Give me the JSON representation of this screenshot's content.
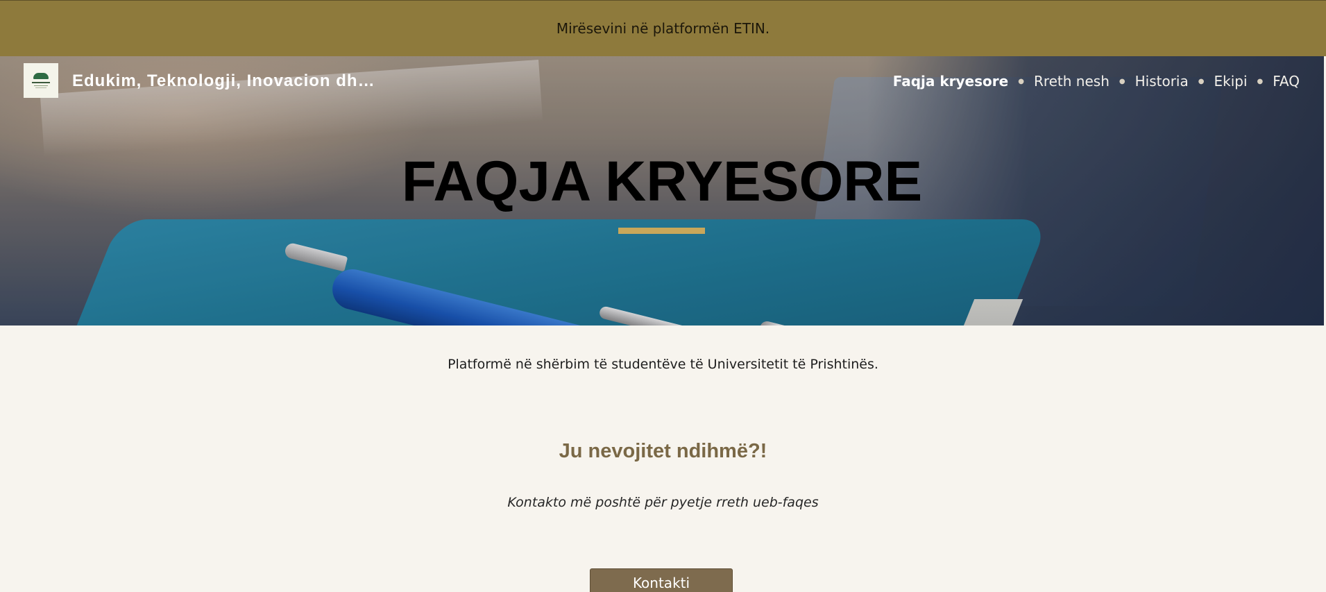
{
  "announcement": {
    "text": "Mirësevini në platformën ETIN."
  },
  "header": {
    "site_title": "Edukim, Teknologji, Inovacion dh…",
    "logo_icon": "etin-logo-icon",
    "nav": [
      {
        "label": "Faqja kryesore",
        "active": true
      },
      {
        "label": "Rreth nesh",
        "active": false
      },
      {
        "label": "Historia",
        "active": false
      },
      {
        "label": "Ekipi",
        "active": false
      },
      {
        "label": "FAQ",
        "active": false
      }
    ]
  },
  "hero": {
    "title": "FAQJA KRYESORE",
    "accent_color": "#c9a75a"
  },
  "content": {
    "tagline": "Platformë në shërbim të studentëve të Universitetit të Prishtinës.",
    "help_heading": "Ju nevojitet ndihmë?!",
    "help_subtext": "Kontakto më poshtë për pyetje rreth ueb-faqes",
    "contact_button": "Kontakti"
  },
  "colors": {
    "announcement_bar": "#8e7a3c",
    "page_background": "#f7f4ee",
    "heading": "#7a6846",
    "button": "#7e6b4e"
  }
}
